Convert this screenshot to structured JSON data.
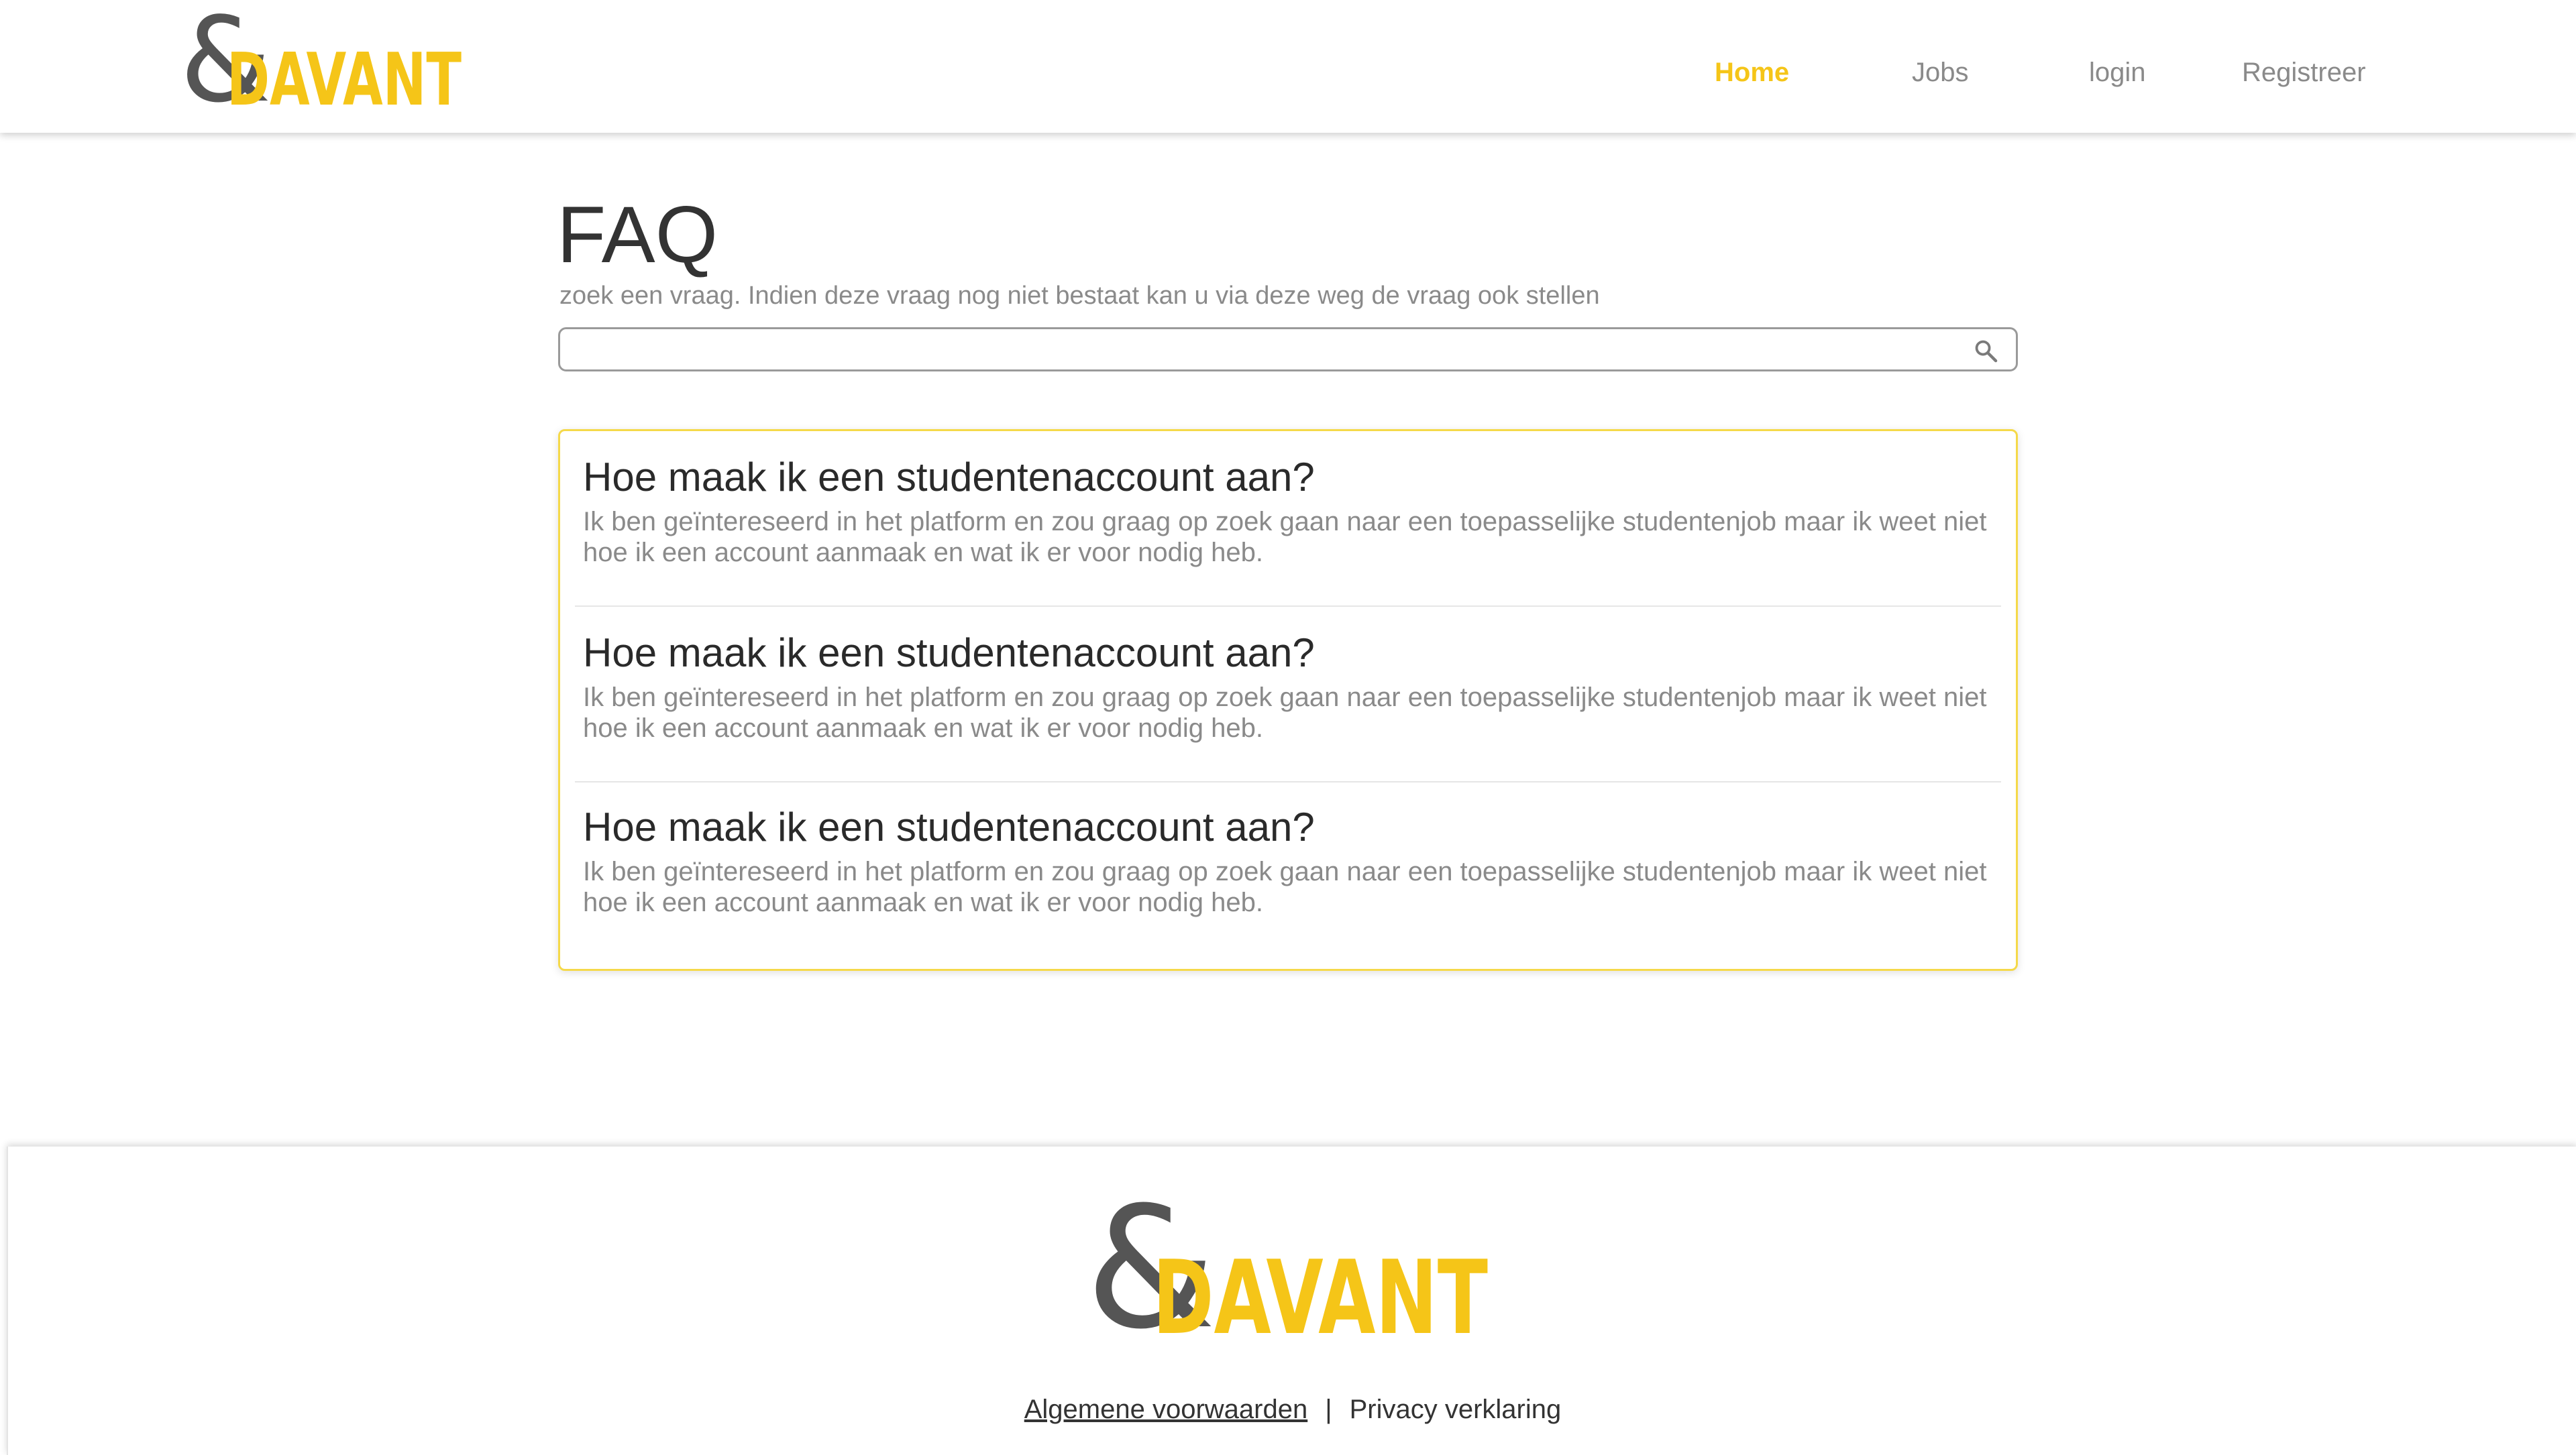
{
  "brand": {
    "logo_text": "DAVANT",
    "logo_symbol": "&",
    "accent_color": "#f5c518",
    "dark_color": "#555555"
  },
  "nav": {
    "items": [
      {
        "label": "Home",
        "active": true
      },
      {
        "label": "Jobs",
        "active": false
      },
      {
        "label": "login",
        "active": false
      },
      {
        "label": "Registreer",
        "active": false
      }
    ]
  },
  "faq": {
    "title": "FAQ",
    "subtitle": "zoek een vraag. Indien deze vraag nog niet bestaat kan u via deze weg de vraag ook stellen",
    "search": {
      "value": "",
      "placeholder": "",
      "icon": "search-icon"
    },
    "items": [
      {
        "question": "Hoe maak ik een studentenaccount aan?",
        "answer": "Ik ben geïntereseerd in het platform en zou graag op zoek gaan naar een toepasselijke studentenjob maar ik weet niet hoe ik een account aanmaak en wat ik er voor nodig heb."
      },
      {
        "question": "Hoe maak ik een studentenaccount aan?",
        "answer": "Ik ben geïntereseerd in het platform en zou graag op zoek gaan naar een toepasselijke studentenjob maar ik weet niet hoe ik een account aanmaak en wat ik er voor nodig heb."
      },
      {
        "question": "Hoe maak ik een studentenaccount aan?",
        "answer": "Ik ben geïntereseerd in het platform en zou graag op zoek gaan naar een toepasselijke studentenjob maar ik weet niet hoe ik een account aanmaak en wat ik er voor nodig heb."
      }
    ]
  },
  "footer": {
    "links": [
      {
        "label": "Algemene voorwaarden"
      },
      {
        "label": "Privacy verklaring"
      }
    ],
    "separator": "|"
  }
}
